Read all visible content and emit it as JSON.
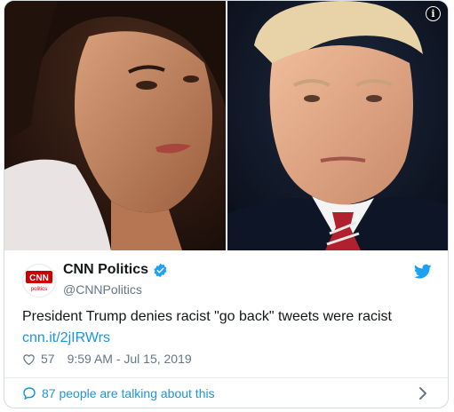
{
  "tweet": {
    "account_name": "CNN Politics",
    "handle": "@CNNPolitics",
    "avatar_text_top": "CNN",
    "avatar_text_bottom": "politics",
    "text": "President Trump denies racist \"go back\" tweets were racist",
    "link": "cnn.it/2jIRWrs",
    "likes": "57",
    "timestamp": "9:59 AM - Jul 15, 2019",
    "talking": "87 people are talking about this"
  },
  "icons": {
    "info": "info-icon",
    "verified": "verified-badge-icon",
    "twitter": "twitter-bird-icon",
    "heart": "heart-icon",
    "chat": "chat-bubble-icon",
    "chevron": "chevron-right-icon"
  },
  "colors": {
    "link_blue": "#1b95e0",
    "cnn_red": "#cc0000",
    "text_dark": "#14171a",
    "text_grey": "#657786"
  }
}
